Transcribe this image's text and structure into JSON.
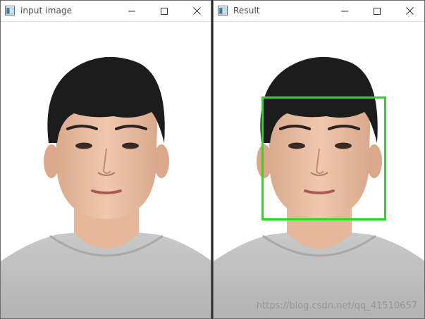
{
  "windows": [
    {
      "title": "input image",
      "has_detection": false
    },
    {
      "title": "Result",
      "has_detection": true
    }
  ],
  "controls": {
    "minimize": "minimize-icon",
    "maximize": "maximize-icon",
    "close": "close-icon"
  },
  "detection": {
    "color": "#17e317",
    "label": "face"
  },
  "watermark": "https://blog.csdn.net/qq_41510657"
}
